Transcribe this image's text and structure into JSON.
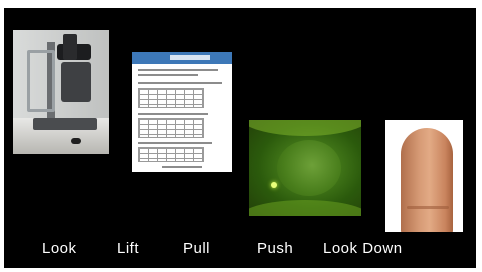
{
  "labels": {
    "look": "Look",
    "lift": "Lift",
    "pull": "Pull",
    "push": "Push",
    "look_down": "Look Down"
  },
  "colors": {
    "background": "#000000",
    "label_text": "#ffffff",
    "stain_green": "#4a7f1c"
  }
}
